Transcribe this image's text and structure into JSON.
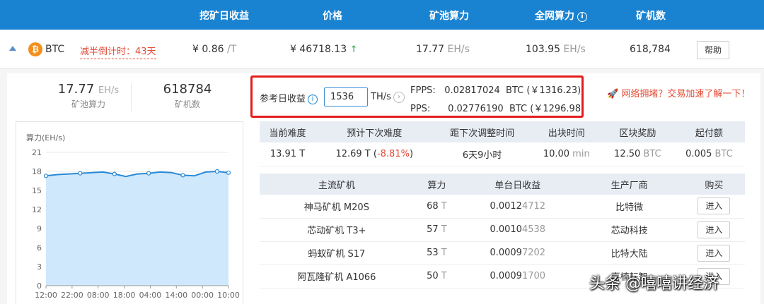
{
  "header": {
    "col_income": "挖矿日收益",
    "col_price": "价格",
    "col_pool_hash": "矿池算力",
    "col_net_hash": "全网算力",
    "col_net_hash_info": "i",
    "col_miners": "矿机数"
  },
  "coin": {
    "icon": "₿",
    "name": "BTC",
    "halving": "减半倒计时：43天",
    "income_value": "¥ 0.86",
    "income_unit": "/T",
    "price": "¥ 46718.13",
    "price_trend": "↑",
    "pool_hash_value": "17.77",
    "pool_hash_unit": "EH/s",
    "net_hash_value": "103.95",
    "net_hash_unit": "EH/s",
    "miners": "618,784",
    "help_label": "帮助"
  },
  "stats": {
    "pool_value": "17.77",
    "pool_unit": "EH/s",
    "pool_label": "矿池算力",
    "miners_value": "618784",
    "miners_label": "矿机数"
  },
  "reference": {
    "label": "参考日收益",
    "info": "i",
    "input_value": "1536",
    "input_unit": "TH/s",
    "go": "›",
    "fpps_label": "FPPS:",
    "fpps_value": "0.02817024",
    "fpps_cny": "BTC (￥1316.23)",
    "pps_label": "PPS:",
    "pps_value": "0.02776190",
    "pps_cny": "BTC (￥1296.98)"
  },
  "congestion_text": "🚀 网络拥堵？交易加速了解一下！",
  "network_table": {
    "headers": [
      "当前难度",
      "预计下次难度",
      "距下次调整时间",
      "出块时间",
      "区块奖励",
      "起付额"
    ],
    "difficulty": "13.91 T",
    "next_difficulty": "12.69 T",
    "next_change_open": "(",
    "next_change": "-8.81%",
    "next_change_close": ")",
    "adjust_time": "6天9小时",
    "block_time_value": "10.00",
    "block_time_unit": "min",
    "reward_value": "12.50",
    "reward_unit": "BTC",
    "min_pay_value": "0.005",
    "min_pay_unit": "BTC"
  },
  "miners_table": {
    "headers": [
      "主流矿机",
      "算力",
      "单台日收益",
      "生产厂商",
      "购买"
    ],
    "rows": [
      {
        "name": "神马矿机 M20S",
        "hash": "68",
        "hash_unit": "T",
        "income_lead": "0.0012",
        "income_tail": "4712",
        "maker": "比特微",
        "buy": "进入"
      },
      {
        "name": "芯动矿机 T3+",
        "hash": "57",
        "hash_unit": "T",
        "income_lead": "0.0010",
        "income_tail": "4538",
        "maker": "芯动科技",
        "buy": "进入"
      },
      {
        "name": "蚂蚁矿机 S17",
        "hash": "53",
        "hash_unit": "T",
        "income_lead": "0.0009",
        "income_tail": "7202",
        "maker": "比特大陆",
        "buy": "进入"
      },
      {
        "name": "阿瓦隆矿机 A1066",
        "hash": "50",
        "hash_unit": "T",
        "income_lead": "0.0009",
        "income_tail": "1700",
        "maker": "嘉楠耘智",
        "buy": "进入"
      }
    ]
  },
  "chart_data": {
    "type": "area",
    "ylabel": "算力(EH/s)",
    "ylim": [
      0,
      21
    ],
    "yticks": [
      "21",
      "18",
      "15",
      "12",
      "9",
      "6",
      "3",
      "0"
    ],
    "categories": [
      "12:00",
      "22:00",
      "08:00",
      "18:00",
      "04:00",
      "14:00",
      "00:00",
      "10:00"
    ],
    "values": [
      17.3,
      17.5,
      17.6,
      17.7,
      17.8,
      17.9,
      17.6,
      17.2,
      17.6,
      17.7,
      17.9,
      17.8,
      17.4,
      17.3,
      17.9,
      18.0,
      17.8
    ],
    "grid": true,
    "line_color": "#2a8ad8",
    "fill_color": "#cfe8fb"
  },
  "watermark": "头条 @嘻嘻讲经济"
}
